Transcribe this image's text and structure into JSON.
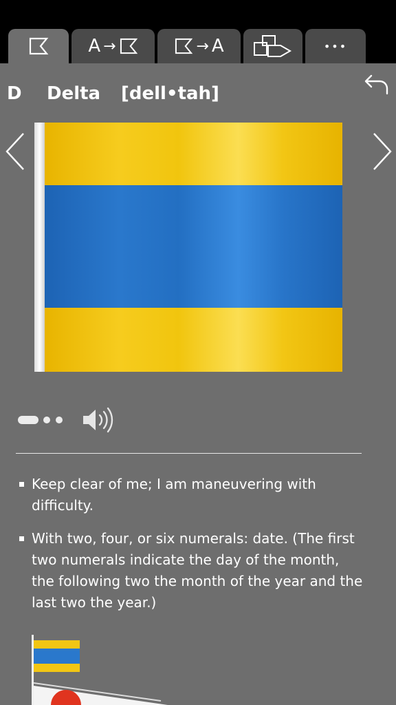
{
  "tabs": [
    {
      "icon": "flag-outline-icon",
      "active": true
    },
    {
      "icon": "letter-to-flag-icon",
      "letter": "A",
      "active": false
    },
    {
      "icon": "flag-to-letter-icon",
      "letter": "A",
      "active": false
    },
    {
      "icon": "flag-combination-icon",
      "active": false
    },
    {
      "icon": "more-icon",
      "label": "•••",
      "active": false
    }
  ],
  "header": {
    "letter": "D",
    "word": "Delta",
    "pronunciation": "[dell•tah]"
  },
  "navigation": {
    "back_icon": "undo-icon",
    "prev_icon": "chevron-left-icon",
    "next_icon": "chevron-right-icon"
  },
  "flag": {
    "name": "delta-flag",
    "colors": {
      "yellow": "#f2c614",
      "blue": "#2a78cc",
      "pole": "#f0f0f0"
    }
  },
  "controls": {
    "page_indicator_count": 3,
    "active_page": 1,
    "speaker_icon": "speaker-icon"
  },
  "meanings": [
    "Keep clear of me; I am maneuvering with difficulty.",
    "With two, four, or six numerals: date. (The first two numerals indicate the day of the month, the following two the month of the year and the last two the year.)"
  ],
  "colors": {
    "background": "#6e6e6e",
    "topbar": "#000000",
    "tab_inactive": "#4a4a4a",
    "text": "#ffffff"
  }
}
